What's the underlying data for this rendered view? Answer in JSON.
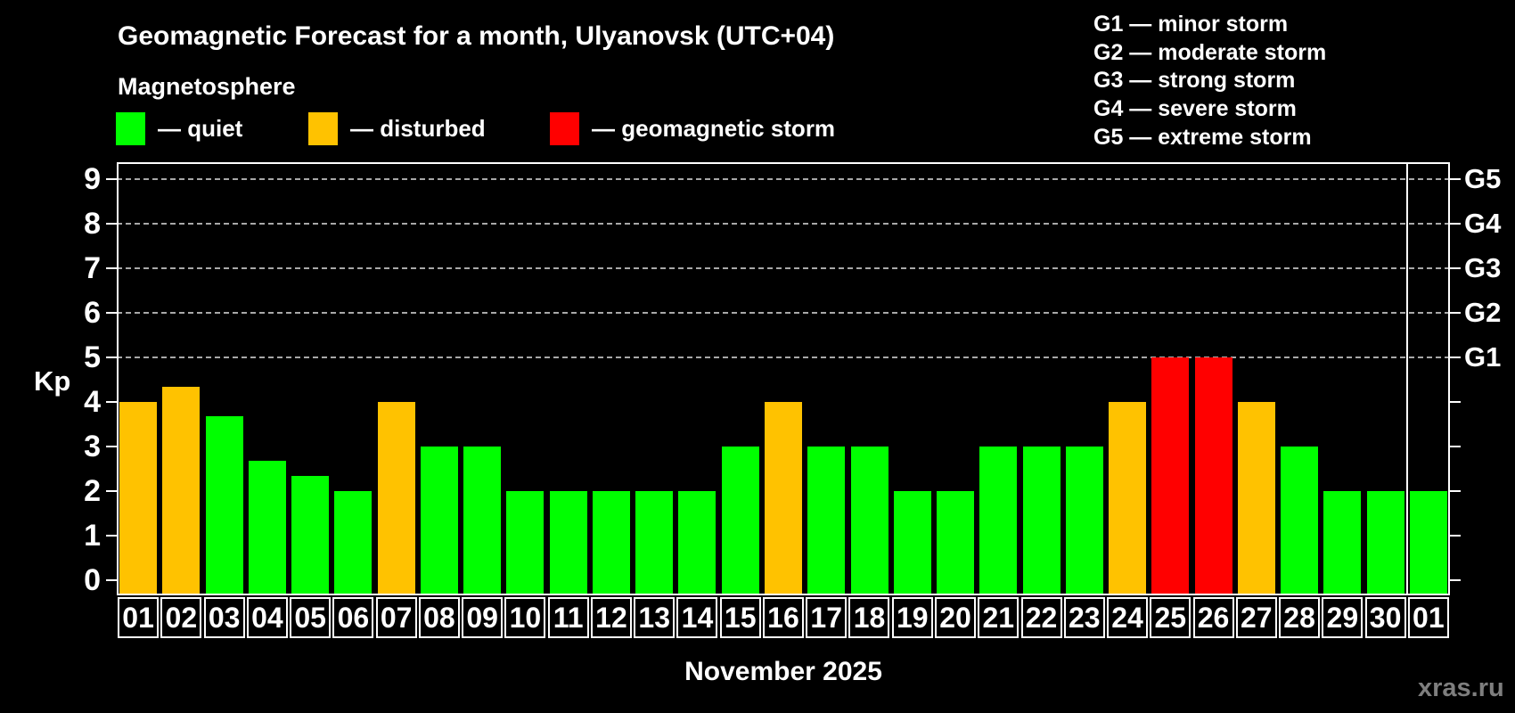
{
  "page": {
    "background": "#000000",
    "watermark": "xras.ru"
  },
  "header": {
    "title": "Geomagnetic Forecast for a month, Ulyanovsk (UTC+04)",
    "subtitle": "Magnetosphere"
  },
  "legend": {
    "items": [
      {
        "status": "quiet",
        "label": "— quiet",
        "color": "#00FF00"
      },
      {
        "status": "disturbed",
        "label": "— disturbed",
        "color": "#FFC200"
      },
      {
        "status": "storm",
        "label": "— geomagnetic storm",
        "color": "#FF0000"
      }
    ]
  },
  "storm_scale_legend": {
    "items": [
      "G1 — minor storm",
      "G2 — moderate storm",
      "G3 — strong storm",
      "G4 — severe storm",
      "G5 — extreme storm"
    ]
  },
  "chart_data": {
    "type": "bar",
    "title": "Geomagnetic Forecast for a month, Ulyanovsk (UTC+04)",
    "subtitle": "Magnetosphere",
    "xlabel": "November 2025",
    "ylabel": "Kp",
    "ylim": [
      0,
      9
    ],
    "yticks": [
      0,
      1,
      2,
      3,
      4,
      5,
      6,
      7,
      8,
      9
    ],
    "gridlines_at_kp": [
      5,
      6,
      7,
      8,
      9
    ],
    "grid": "horizontal dashed lines at Kp 5-9 only",
    "legend_position": "top-left",
    "right_axis_labels": [
      {
        "kp": 5,
        "label": "G1"
      },
      {
        "kp": 6,
        "label": "G2"
      },
      {
        "kp": 7,
        "label": "G3"
      },
      {
        "kp": 8,
        "label": "G4"
      },
      {
        "kp": 9,
        "label": "G5"
      }
    ],
    "categories": [
      "01",
      "02",
      "03",
      "04",
      "05",
      "06",
      "07",
      "08",
      "09",
      "10",
      "11",
      "12",
      "13",
      "14",
      "15",
      "16",
      "17",
      "18",
      "19",
      "20",
      "21",
      "22",
      "23",
      "24",
      "25",
      "26",
      "27",
      "28",
      "29",
      "30",
      "01"
    ],
    "values": [
      4,
      4.33,
      3.67,
      2.67,
      2.33,
      2,
      4,
      3,
      3,
      2,
      2,
      2,
      2,
      2,
      3,
      4,
      3,
      3,
      2,
      2,
      3,
      3,
      3,
      4,
      5,
      5,
      4,
      3,
      2,
      2,
      2
    ],
    "thresholds": {
      "disturbed_min": 4,
      "storm_min": 5
    },
    "month_separator_after_index": 29
  },
  "axis_colors": {
    "axis": "#FFFFFF",
    "gridline": "#A8A8A8",
    "text": "#FFFFFF"
  },
  "footer": {
    "month_label": "November 2025"
  }
}
